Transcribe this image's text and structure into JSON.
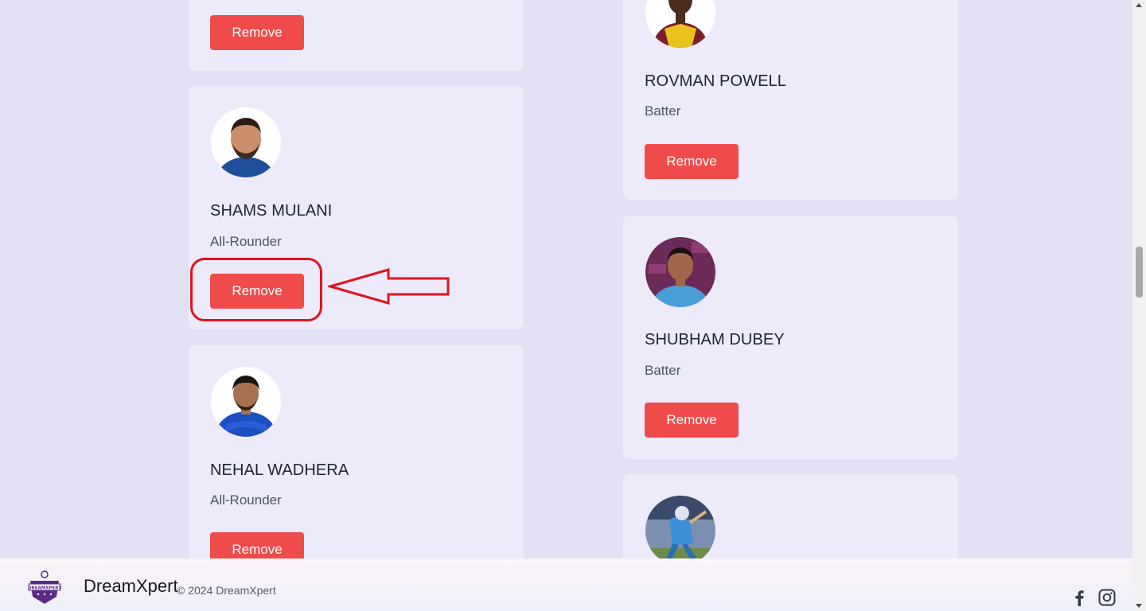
{
  "left_column": [
    {
      "name": "",
      "role": "",
      "button": "Remove"
    },
    {
      "name": "SHAMS MULANI",
      "role": "All-Rounder",
      "button": "Remove"
    },
    {
      "name": "NEHAL WADHERA",
      "role": "All-Rounder",
      "button": "Remove"
    }
  ],
  "right_column": [
    {
      "name": "ROVMAN POWELL",
      "role": "Batter",
      "button": "Remove"
    },
    {
      "name": "SHUBHAM DUBEY",
      "role": "Batter",
      "button": "Remove"
    }
  ],
  "footer": {
    "brand": "DreamXpert",
    "copyright": "© 2024 DreamXpert",
    "logo_text": "DREAMXPERT",
    "social_icons": [
      "facebook-icon",
      "instagram-icon"
    ]
  },
  "colors": {
    "remove_button": "#ef4b4b",
    "card_bg": "#eceafb",
    "page_bg": "#e2e0f4",
    "annotation": "#e0141e"
  }
}
